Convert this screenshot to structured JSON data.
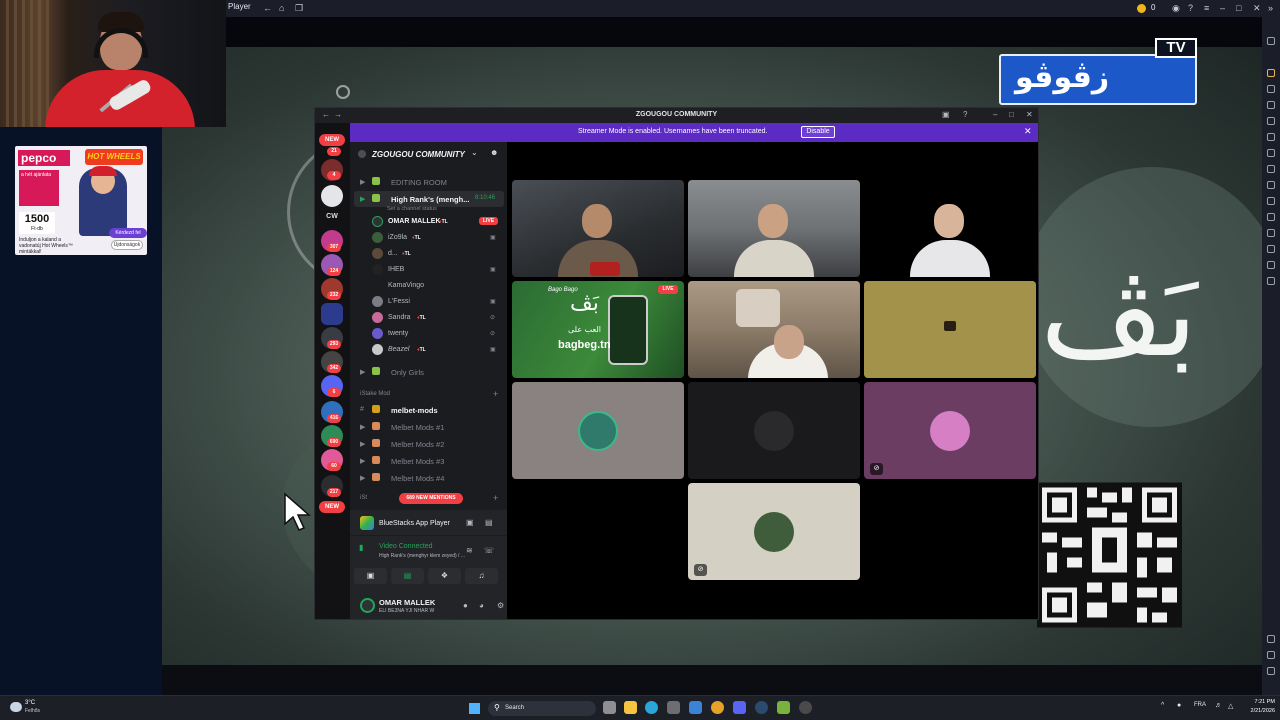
{
  "bluestacks": {
    "title": "Player",
    "coins": "0"
  },
  "overlay": {
    "channel_logo": "زڤوڤو",
    "channel_tv": "TV",
    "big_glyph": "بَڤ"
  },
  "ad": {
    "brand": "pepco",
    "partner": "HOT WHEELS",
    "tag": "a hét ajánlata",
    "price": "1500",
    "price_unit": "Ft·db",
    "footer": "Induljon a kaland a vadonatúj Hot Wheels™ mintákkal!",
    "cta_primary": "Kérdezd fel",
    "cta_secondary": "Újdonságok"
  },
  "discord": {
    "window_title": "ZGOUGOU COMMUNITY",
    "banner": {
      "message": "Streamer Mode is enabled. Usernames have been truncated.",
      "button": "Disable"
    },
    "guilds": {
      "new_top": "NEW",
      "cw": "CW",
      "badges": [
        "21",
        "4",
        "307",
        "124",
        "232",
        "293",
        "342",
        "6",
        "416",
        "690",
        "60",
        "217"
      ],
      "new_bottom": "NEW"
    },
    "server": {
      "name": "ZGOUGOU COMMUNITY",
      "channels": [
        {
          "name": "EDITING ROOM"
        },
        {
          "name": "High Rank's (mengh...",
          "timer": "8:10:46",
          "status": "Set a channel status"
        },
        {
          "name": "Only Girls"
        }
      ],
      "voice_users": [
        {
          "name": "OMAR MALLEK",
          "tag": "TL",
          "live": "LIVE"
        },
        {
          "name": "iZo9la",
          "tag": "TL"
        },
        {
          "name": "d...",
          "tag": "TL"
        },
        {
          "name": "IHEB"
        },
        {
          "name": "KamaVingo"
        },
        {
          "name": "L'Fessi"
        },
        {
          "name": "Sandra",
          "tag": "TL"
        },
        {
          "name": "twenty"
        },
        {
          "name": "Beazel",
          "tag": "TL"
        }
      ],
      "category": "iStake Mod",
      "text_channel": "melbet-mods",
      "mod_channels": [
        "Melbet Mods #1",
        "Melbet Mods #2",
        "Melbet Mods #3",
        "Melbet Mods #4"
      ],
      "category2": "iSt",
      "new_mentions": "689 NEW MENTIONS"
    },
    "panel": {
      "activity": "BlueStacks App Player",
      "voice_state": "Video Connected",
      "voice_sub": "High Rank's (menghyr klem zeyed) / ...",
      "user_name": "OMAR MALLEK",
      "user_status": "ELI BE3NA YJI NHAR W"
    },
    "tiles": {
      "live_label": "LIVE",
      "promo_site": "bagbeg.tn",
      "promo_brand": "بَڤ",
      "promo_top": "العب على",
      "promo_badge": "Bago Bago"
    }
  },
  "taskbar": {
    "temperature": "3°C",
    "condition": "Felhős",
    "search_placeholder": "Search",
    "language": "FRA",
    "time": "7:21 PM",
    "date": "2/21/2026"
  },
  "colors": {
    "discord_accent": "#5b2bc4",
    "live_red": "#f23f43",
    "voice_green": "#23a55a",
    "channel_logo_blue": "#1d58c9"
  },
  "icons": {
    "search": "search-icon",
    "settings": "gear-icon",
    "mute": "mic-muted-icon"
  }
}
